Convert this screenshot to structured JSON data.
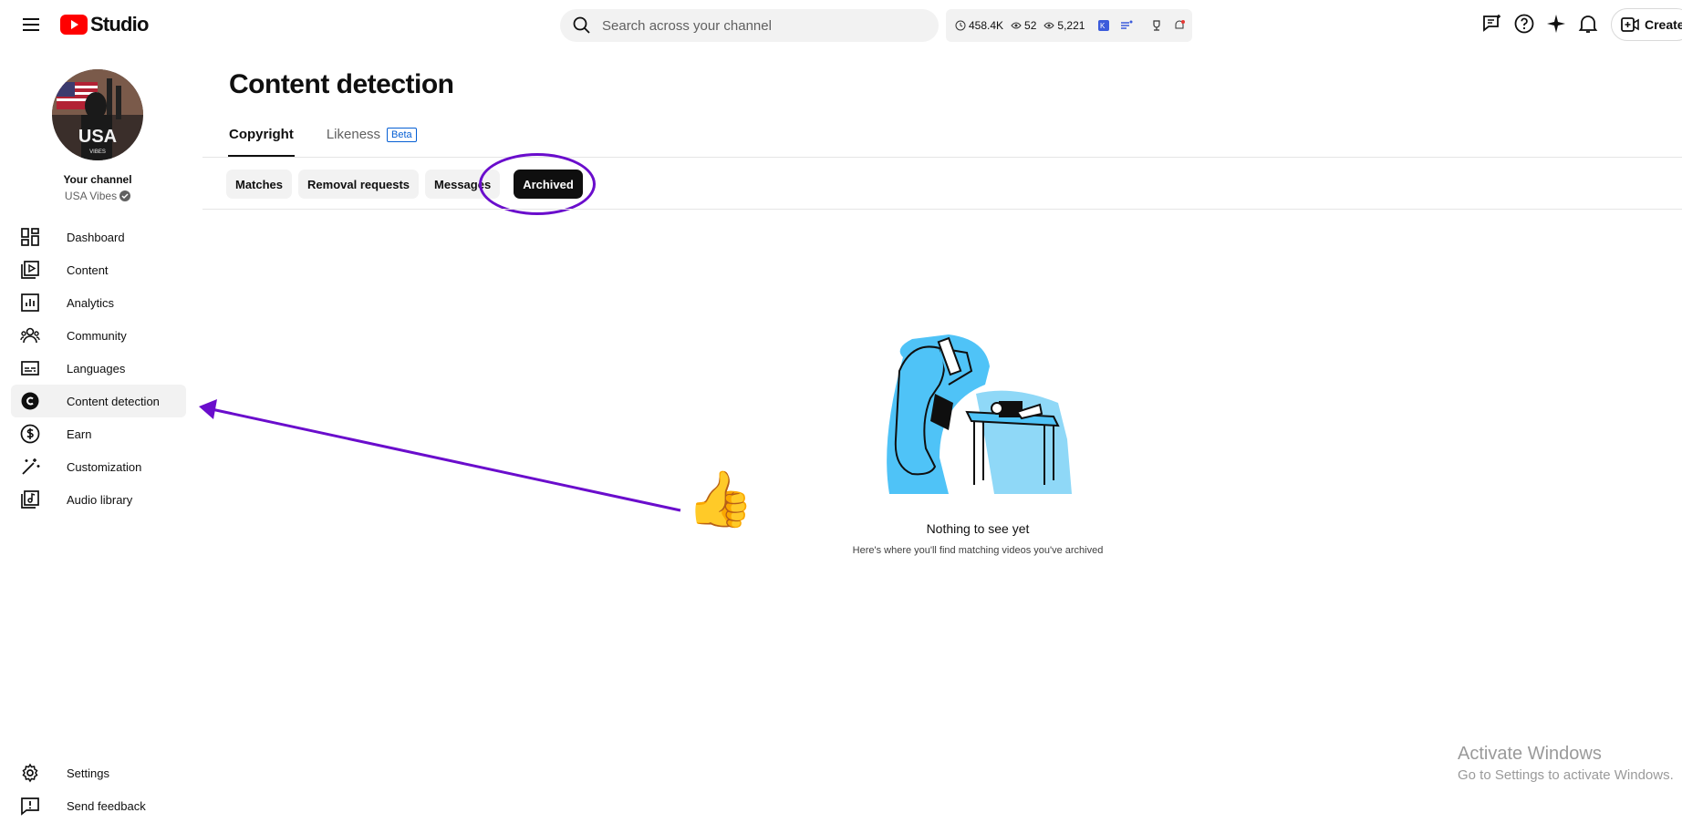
{
  "header": {
    "logo_text": "Studio",
    "search_placeholder": "Search across your channel",
    "stats": {
      "watch_time": "458.4K",
      "views_small": "52",
      "views": "5,221"
    },
    "create_label": "Create"
  },
  "sidebar": {
    "channel_label": "Your channel",
    "channel_name": "USA Vibes",
    "items": [
      {
        "label": "Dashboard",
        "icon": "dashboard-icon"
      },
      {
        "label": "Content",
        "icon": "content-icon"
      },
      {
        "label": "Analytics",
        "icon": "analytics-icon"
      },
      {
        "label": "Community",
        "icon": "community-icon"
      },
      {
        "label": "Languages",
        "icon": "languages-icon"
      },
      {
        "label": "Content detection",
        "icon": "copyright-icon",
        "active": true
      },
      {
        "label": "Earn",
        "icon": "dollar-icon"
      },
      {
        "label": "Customization",
        "icon": "magic-wand-icon"
      },
      {
        "label": "Audio library",
        "icon": "audio-library-icon"
      }
    ],
    "bottom_items": [
      {
        "label": "Settings",
        "icon": "gear-icon"
      },
      {
        "label": "Send feedback",
        "icon": "feedback-icon"
      }
    ]
  },
  "main": {
    "title": "Content detection",
    "tabs": [
      {
        "label": "Copyright",
        "active": true
      },
      {
        "label": "Likeness",
        "badge": "Beta"
      }
    ],
    "chips": [
      {
        "label": "Matches"
      },
      {
        "label": "Removal requests"
      },
      {
        "label": "Messages"
      },
      {
        "label": "Archived",
        "active": true
      }
    ],
    "empty_state": {
      "title": "Nothing to see yet",
      "subtitle": "Here's where you'll find matching videos you've archived"
    }
  },
  "overlay": {
    "thumb_emoji": "👍",
    "watermark_title": "Activate Windows",
    "watermark_sub": "Go to Settings to activate Windows.",
    "annotation_color": "#6a0dcc"
  },
  "colors": {
    "brand_red": "#ff0000",
    "accent_blue": "#065fd4",
    "illustration_blue": "#4fc3f7"
  }
}
